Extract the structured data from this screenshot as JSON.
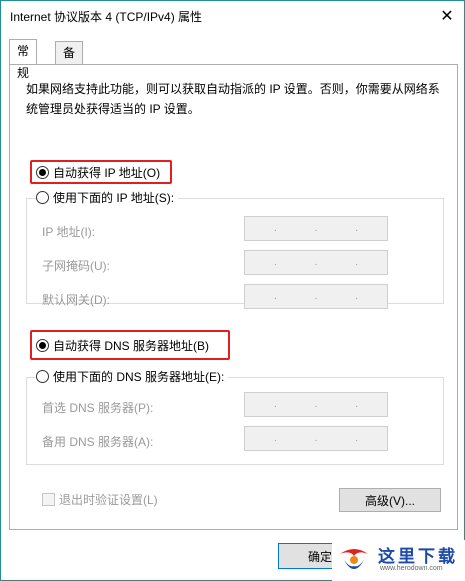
{
  "window": {
    "title": "Internet 协议版本 4 (TCP/IPv4) 属性",
    "close_glyph": "✕"
  },
  "tabs": [
    {
      "label": "常规"
    },
    {
      "label": "备用配置"
    }
  ],
  "description": "如果网络支持此功能，则可以获取自动指派的 IP 设置。否则，你需要从网络系统管理员处获得适当的 IP 设置。",
  "ip": {
    "auto_label": "自动获得 IP 地址(O)",
    "manual_label": "使用下面的 IP 地址(S):",
    "fields": [
      {
        "label": "IP 地址(I):"
      },
      {
        "label": "子网掩码(U):"
      },
      {
        "label": "默认网关(D):"
      }
    ]
  },
  "dns": {
    "auto_label": "自动获得 DNS 服务器地址(B)",
    "manual_label": "使用下面的 DNS 服务器地址(E):",
    "fields": [
      {
        "label": "首选 DNS 服务器(P):"
      },
      {
        "label": "备用 DNS 服务器(A):"
      }
    ]
  },
  "validate_label": "退出时验证设置(L)",
  "advanced_button": "高级(V)...",
  "ok_button": "确定",
  "ip_dot": ".",
  "colors": {
    "highlight": "#e02020",
    "window_border": "#1f8f8f",
    "primary_border": "#0078d7"
  },
  "watermark": {
    "text": "这里下载",
    "url": "www.herodown.com"
  }
}
